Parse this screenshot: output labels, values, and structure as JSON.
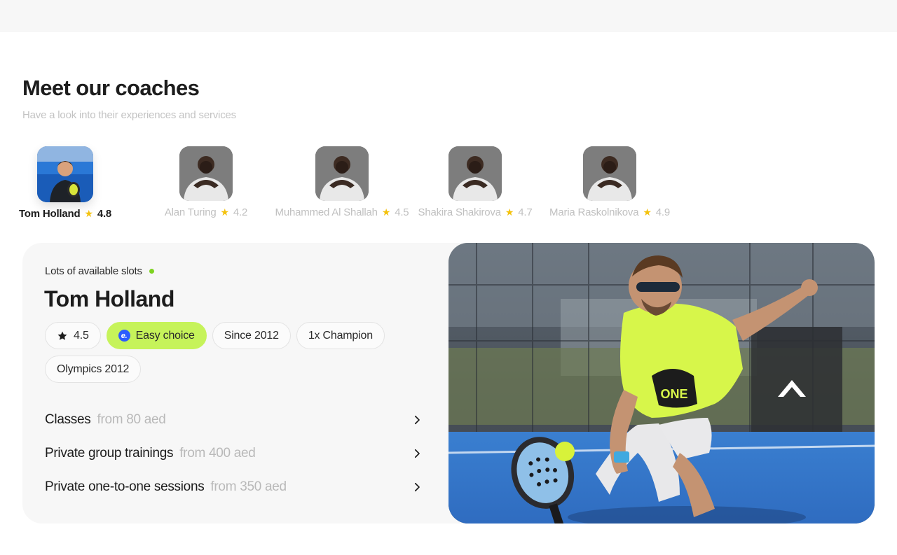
{
  "header": {
    "title": "Meet our coaches",
    "subtitle": "Have a look into their experiences and services"
  },
  "coaches": [
    {
      "name": "Tom Holland",
      "rating": "4.8",
      "selected": true
    },
    {
      "name": "Alan Turing",
      "rating": "4.2",
      "selected": false
    },
    {
      "name": "Muhammed Al Shallah",
      "rating": "4.5",
      "selected": false
    },
    {
      "name": "Shakira Shakirova",
      "rating": "4.7",
      "selected": false
    },
    {
      "name": "Maria Raskolnikova",
      "rating": "4.9",
      "selected": false
    }
  ],
  "detail": {
    "availability": "Lots of available slots",
    "name": "Tom Holland",
    "chips": {
      "rating": "4.5",
      "easy_choice": "Easy choice",
      "easy_badge": "e.",
      "since": "Since 2012",
      "champion": "1x Champion",
      "olympics": "Olympics 2012"
    },
    "services": [
      {
        "title": "Classes",
        "price": "from 80 aed"
      },
      {
        "title": "Private group trainings",
        "price": "from 400 aed"
      },
      {
        "title": "Private one-to-one sessions",
        "price": "from 350 aed"
      }
    ]
  },
  "icons": {
    "rating_star": "star-icon",
    "availability_dot": "status-dot-icon",
    "chevron": "chevron-right-icon"
  },
  "colors": {
    "accent_green": "#c6f35a",
    "status_green": "#7ed321",
    "star_yellow": "#f4c20d",
    "badge_blue": "#2b5cff",
    "card_bg": "#f7f7f7"
  }
}
